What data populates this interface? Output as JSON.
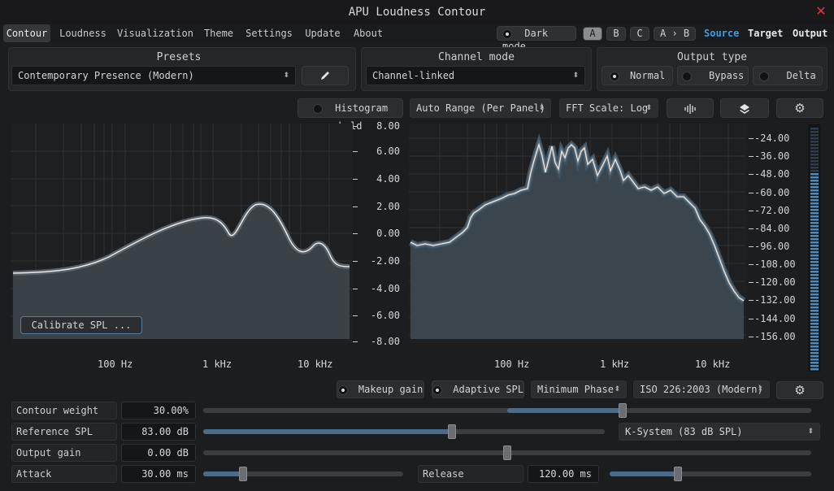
{
  "app": {
    "title": "APU Loudness Contour",
    "close_icon": "close-icon"
  },
  "menu": {
    "items": [
      "Contour",
      "Loudness",
      "Visualization",
      "Theme",
      "Settings",
      "Update",
      "About"
    ],
    "active": "Contour"
  },
  "topbar": {
    "dark_mode_label": "Dark mode",
    "dark_mode_on": true,
    "ab_buttons": [
      "A",
      "B",
      "C",
      "A › B"
    ],
    "ab_selected": "A",
    "view_tabs": [
      "Source",
      "Target",
      "Output"
    ],
    "view_selected": "Source",
    "accent": "#3e9ce0"
  },
  "presets": {
    "header": "Presets",
    "selected": "Contemporary Presence (Modern)",
    "edit_icon": "pencil-icon"
  },
  "channel_mode": {
    "header": "Channel mode",
    "selected": "Channel-linked"
  },
  "output_type": {
    "header": "Output type",
    "options": [
      "Normal",
      "Bypass",
      "Delta"
    ],
    "selected": "Normal"
  },
  "viz_toolbar": {
    "histogram_hold_label": "Histogram hold",
    "histogram_hold_on": false,
    "auto_range": "Auto Range (Per Panel)",
    "fft_scale": "FFT Scale: Log",
    "icons": [
      "waveform-icon",
      "layers-icon",
      "gear-icon"
    ]
  },
  "contour_plot": {
    "y_ticks": [
      "8.00",
      "6.00",
      "4.00",
      "2.00",
      "0.00",
      "-2.00",
      "-4.00",
      "-6.00",
      "-8.00"
    ],
    "x_labels": [
      "100 Hz",
      "1 kHz",
      "10 kHz"
    ],
    "calibrate_label": "Calibrate SPL ..."
  },
  "spectrum_plot": {
    "y_ticks": [
      "-24.00",
      "-36.00",
      "-48.00",
      "-60.00",
      "-72.00",
      "-84.00",
      "-96.00",
      "-108.00",
      "-120.00",
      "-132.00",
      "-144.00",
      "-156.00"
    ],
    "x_labels": [
      "100 Hz",
      "1 kHz",
      "10 kHz"
    ],
    "meter_color": "#3e8fd0"
  },
  "options_row": {
    "makeup_gain_label": "Makeup gain",
    "makeup_gain_on": true,
    "adaptive_spl_label": "Adaptive SPL",
    "adaptive_spl_on": true,
    "phase": "Minimum Phase",
    "standard": "ISO 226:2003 (Modern)"
  },
  "params": {
    "contour_weight": {
      "label": "Contour weight",
      "value": "30.00%",
      "fraction": 0.69,
      "fill_from": 0.5
    },
    "reference_spl": {
      "label": "Reference SPL",
      "value": "83.00 dB",
      "fraction": 0.62,
      "system": "K-System (83 dB SPL)"
    },
    "output_gain": {
      "label": "Output gain",
      "value": "0.00 dB",
      "fraction": 0.5
    },
    "attack": {
      "label": "Attack",
      "value": "30.00 ms",
      "fraction": 0.2
    },
    "release": {
      "label": "Release",
      "value": "120.00 ms",
      "fraction": 0.34
    }
  }
}
